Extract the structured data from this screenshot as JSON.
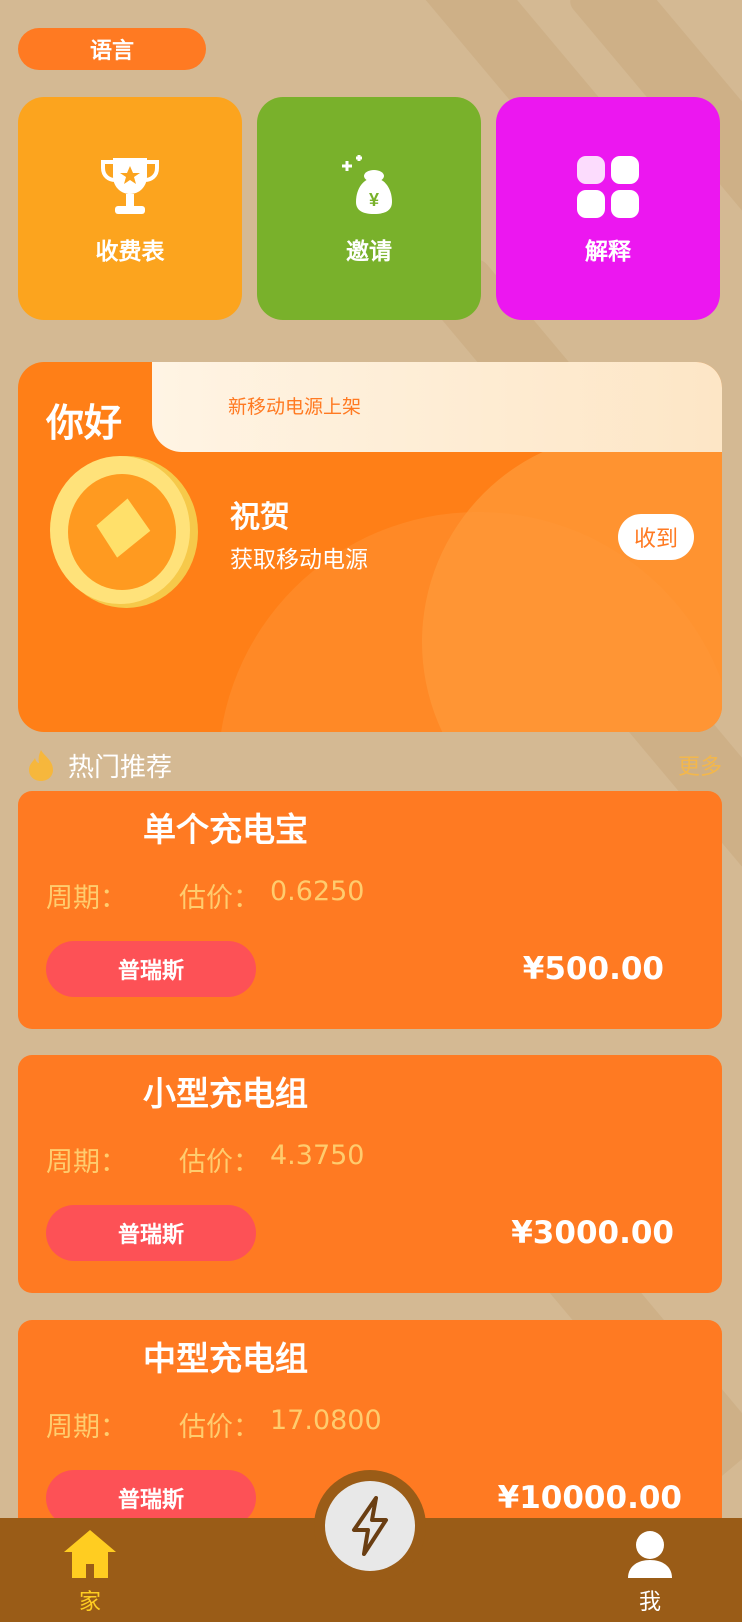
{
  "header": {
    "language_label": "语言"
  },
  "tiles": [
    {
      "label": "收费表",
      "icon": "trophy-icon",
      "color": "#fca41e"
    },
    {
      "label": "邀请",
      "icon": "money-bag-icon",
      "color": "#79b12b"
    },
    {
      "label": "解释",
      "icon": "grid-icon",
      "color": "#ec17f0"
    }
  ],
  "hero": {
    "hello": "你好",
    "headline": "新移动电源上架",
    "congrats": "祝贺",
    "subtitle": "获取移动电源",
    "receive_label": "收到"
  },
  "section": {
    "title": "热门推荐",
    "more_label": "更多"
  },
  "products": [
    {
      "name": "单个充电宝",
      "cycle_label": "周期：",
      "estimate_label": "估价：",
      "estimate_value": "0.6250",
      "tag": "普瑞斯",
      "price": "¥500.00"
    },
    {
      "name": "小型充电组",
      "cycle_label": "周期：",
      "estimate_label": "估价：",
      "estimate_value": "4.3750",
      "tag": "普瑞斯",
      "price": "¥3000.00"
    },
    {
      "name": "中型充电组",
      "cycle_label": "周期：",
      "estimate_label": "估价：",
      "estimate_value": "17.0800",
      "tag": "普瑞斯",
      "price": "¥10000.00"
    }
  ],
  "tabbar": {
    "home_label": "家",
    "me_label": "我",
    "center_icon": "lightning-icon"
  }
}
